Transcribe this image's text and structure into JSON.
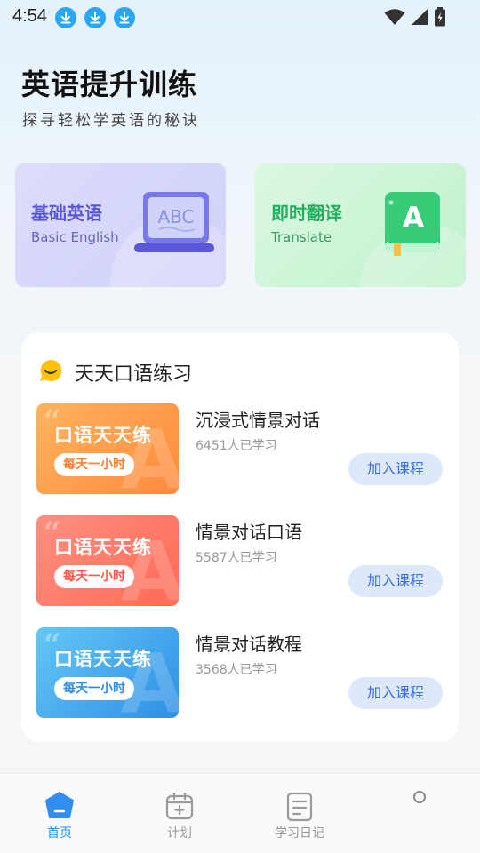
{
  "status_bar": {
    "time": "4:54",
    "download_icons": [
      "download-icon",
      "download-icon",
      "download-icon"
    ],
    "icons": [
      "wifi-icon",
      "signal-icon",
      "battery-icon"
    ]
  },
  "header": {
    "title": "英语提升训练",
    "subtitle": "探寻轻松学英语的秘诀"
  },
  "feature_cards": [
    {
      "title": "基础英语",
      "subtitle": "Basic English",
      "icon": "laptop-abc-icon",
      "accent": "#5a55d6"
    },
    {
      "title": "即时翻译",
      "subtitle": "Translate",
      "icon": "book-a-icon",
      "accent": "#25b05f"
    }
  ],
  "practice": {
    "title": "天天口语练习",
    "icon": "smile-chat-icon",
    "courses": [
      {
        "thumb_title": "口语天天练",
        "thumb_tag": "每天一小时",
        "name": "沉浸式情景对话",
        "learners": "6451人已学习",
        "button": "加入课程",
        "color": "#ff8a3d"
      },
      {
        "thumb_title": "口语天天练",
        "thumb_tag": "每天一小时",
        "name": "情景对话口语",
        "learners": "5587人已学习",
        "button": "加入课程",
        "color": "#ff6a55"
      },
      {
        "thumb_title": "口语天天练",
        "thumb_tag": "每天一小时",
        "name": "情景对话教程",
        "learners": "3568人已学习",
        "button": "加入课程",
        "color": "#2f8fe6"
      }
    ]
  },
  "bottom_nav": {
    "items": [
      {
        "label": "首页",
        "icon": "home-icon",
        "active": true
      },
      {
        "label": "计划",
        "icon": "calendar-plus-icon",
        "active": false
      },
      {
        "label": "学习日记",
        "icon": "notebook-icon",
        "active": false
      },
      {
        "label": "",
        "icon": "circle-icon",
        "active": false
      }
    ],
    "active_color": "#2f8ef0"
  }
}
